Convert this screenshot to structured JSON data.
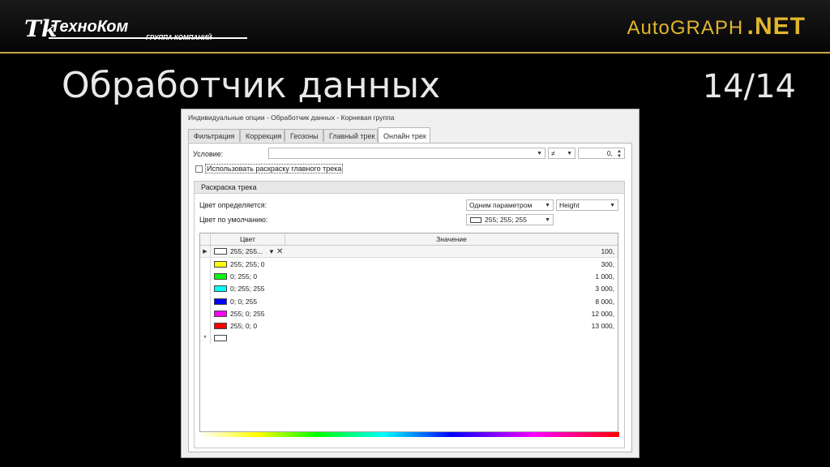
{
  "header": {
    "logo_left_mark": "Tk",
    "logo_left_name": "ТехноКом",
    "logo_left_sub": "ГРУППА КОМПАНИЙ",
    "logo_right_ag": "AutoGRAPH",
    "logo_right_net": ".NET"
  },
  "slide": {
    "title": "Обработчик данных",
    "page": "14/14"
  },
  "dialog": {
    "title": "Индивидуальные опции - Обработчик данных - Корневая группа",
    "tabs": [
      {
        "label": "Фильтрация",
        "active": false
      },
      {
        "label": "Коррекция",
        "active": false
      },
      {
        "label": "Геозоны",
        "active": false
      },
      {
        "label": "Главный трек",
        "active": false
      },
      {
        "label": "Онлайн трек",
        "active": true
      }
    ],
    "condition": {
      "label": "Условие:",
      "value": "",
      "operator": "≠",
      "number": "0,"
    },
    "use_main_color": {
      "label": "Использовать раскраску главного трека",
      "checked": false
    },
    "track_color": {
      "group_title": "Раскраска трека",
      "determined_label": "Цвет определяется:",
      "determined_value": "Одним параметром",
      "param_value": "Height",
      "default_label": "Цвет по умолчанию:",
      "default_value": "255; 255; 255",
      "default_color": "#ffffff"
    },
    "grid": {
      "col_color": "Цвет",
      "col_value": "Значение",
      "rows": [
        {
          "color": "#ffffff",
          "label": "255; 255...",
          "value": "100,",
          "selected": true
        },
        {
          "color": "#ffff00",
          "label": "255; 255; 0",
          "value": "300,"
        },
        {
          "color": "#00ff00",
          "label": "0; 255; 0",
          "value": "1 000,"
        },
        {
          "color": "#00ffff",
          "label": "0; 255; 255",
          "value": "3 000,"
        },
        {
          "color": "#0000ff",
          "label": "0; 0; 255",
          "value": "8 000,"
        },
        {
          "color": "#ff00ff",
          "label": "255; 0; 255",
          "value": "12 000,"
        },
        {
          "color": "#ff0000",
          "label": "255; 0; 0",
          "value": "13 000,"
        }
      ],
      "new_row_marker": "*"
    }
  }
}
